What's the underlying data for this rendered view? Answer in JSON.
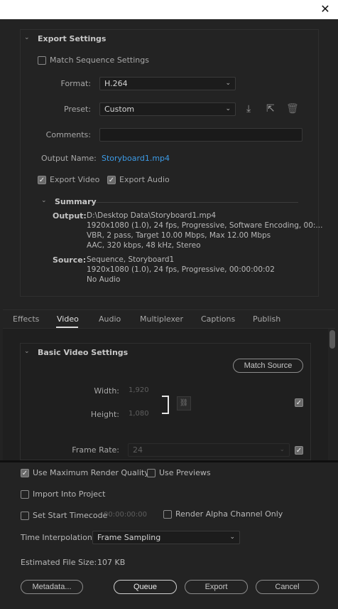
{
  "export_settings": {
    "title": "Export Settings",
    "match_sequence_label": "Match Sequence Settings",
    "format_label": "Format:",
    "format_value": "H.264",
    "preset_label": "Preset:",
    "preset_value": "Custom",
    "comments_label": "Comments:",
    "output_name_label": "Output Name:",
    "output_name_value": "Storyboard1.mp4",
    "export_video_label": "Export Video",
    "export_audio_label": "Export Audio"
  },
  "summary": {
    "title": "Summary",
    "output_label": "Output:",
    "output_lines": [
      "D:\\Desktop Data\\Storyboard1.mp4",
      "1920x1080 (1.0), 24 fps, Progressive, Software Encoding, 00:...",
      "VBR, 2 pass, Target 10.00 Mbps, Max 12.00 Mbps",
      "AAC, 320 kbps, 48 kHz, Stereo"
    ],
    "source_label": "Source:",
    "source_lines": [
      "Sequence, Storyboard1",
      "1920x1080 (1.0), 24 fps, Progressive, 00:00:00:02",
      "No Audio"
    ]
  },
  "tabs": [
    "Effects",
    "Video",
    "Audio",
    "Multiplexer",
    "Captions",
    "Publish"
  ],
  "video": {
    "section_title": "Basic Video Settings",
    "match_source_label": "Match Source",
    "width_label": "Width:",
    "width_value": "1,920",
    "height_label": "Height:",
    "height_value": "1,080",
    "frame_rate_label": "Frame Rate:",
    "frame_rate_value": "24"
  },
  "bottom": {
    "max_render_label": "Use Maximum Render Quality",
    "use_previews_label": "Use Previews",
    "import_label": "Import Into Project",
    "start_timecode_label": "Set Start Timecode",
    "start_timecode_value": "00:00:00:00",
    "alpha_label": "Render Alpha Channel Only",
    "time_interp_label": "Time Interpolation:",
    "time_interp_value": "Frame Sampling",
    "file_size_label": "Estimated File Size:",
    "file_size_value": "107 KB",
    "metadata_label": "Metadata...",
    "queue_label": "Queue",
    "export_label": "Export",
    "cancel_label": "Cancel"
  },
  "colors": {
    "background": "#232323",
    "link": "#3d9be6",
    "title_bar": "#ffffff"
  }
}
